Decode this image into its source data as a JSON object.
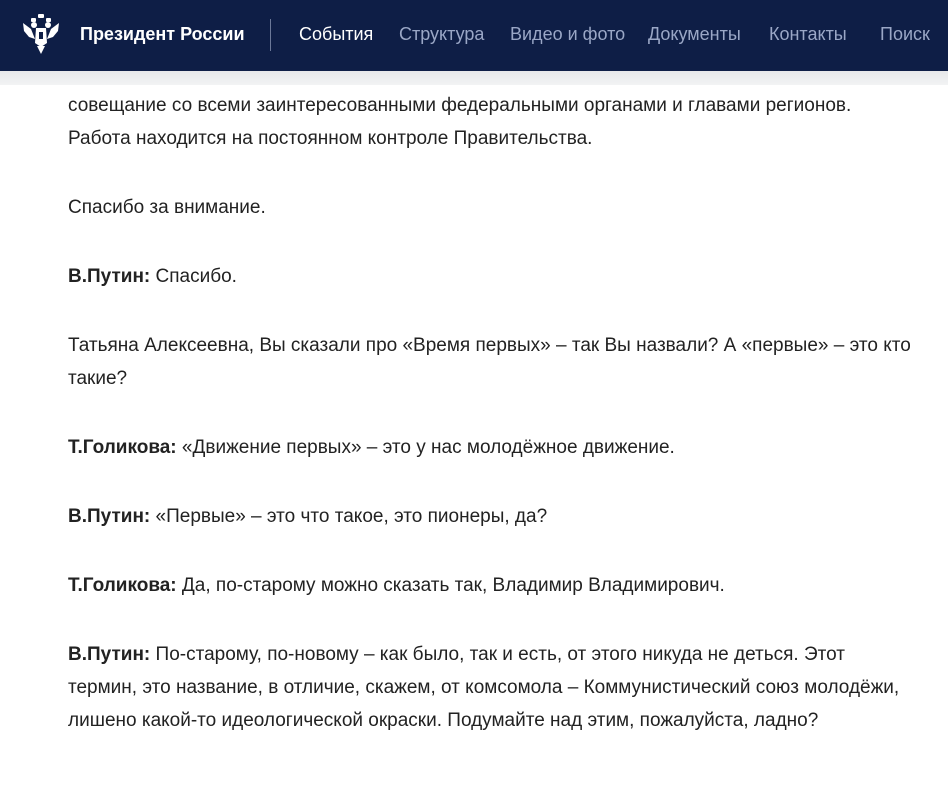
{
  "header": {
    "site_title": "Президент России",
    "nav": [
      {
        "label": "События",
        "active": true
      },
      {
        "label": "Структура",
        "active": false
      },
      {
        "label": "Видео и фото",
        "active": false
      },
      {
        "label": "Документы",
        "active": false
      },
      {
        "label": "Контакты",
        "active": false
      },
      {
        "label": "Поиск",
        "active": false
      }
    ],
    "emblem_icon": "double-headed-eagle-icon"
  },
  "colors": {
    "header_bg": "#0e1e46",
    "nav_inactive": "#9aa7c6",
    "nav_active": "#ffffff",
    "text": "#222222"
  },
  "article": {
    "paragraphs": [
      {
        "speaker": "",
        "text": "совещание со всеми заинтересованными федеральными органами и главами регионов. Работа находится на постоянном контроле Правительства."
      },
      {
        "speaker": "",
        "text": "Спасибо за внимание."
      },
      {
        "speaker": "В.Путин:",
        "text": "Спасибо."
      },
      {
        "speaker": "",
        "text": "Татьяна Алексеевна, Вы сказали про «Время первых» – так Вы назвали? А «первые» – это кто такие?"
      },
      {
        "speaker": "Т.Голикова:",
        "text": "«Движение первых» – это у нас молодёжное движение."
      },
      {
        "speaker": "В.Путин:",
        "text": "«Первые» – это что такое, это пионеры, да?"
      },
      {
        "speaker": "Т.Голикова:",
        "text": "Да, по‑старому можно сказать так, Владимир Владимирович."
      },
      {
        "speaker": "В.Путин:",
        "text": "По‑старому, по‑новому – как было, так и есть, от этого никуда не деться. Этот термин, это название, в отличие, скажем, от комсомола – Коммунистический союз молодёжи, лишено какой‑то идеологической окраски. Подумайте над этим, пожалуйста, ладно?"
      }
    ]
  }
}
